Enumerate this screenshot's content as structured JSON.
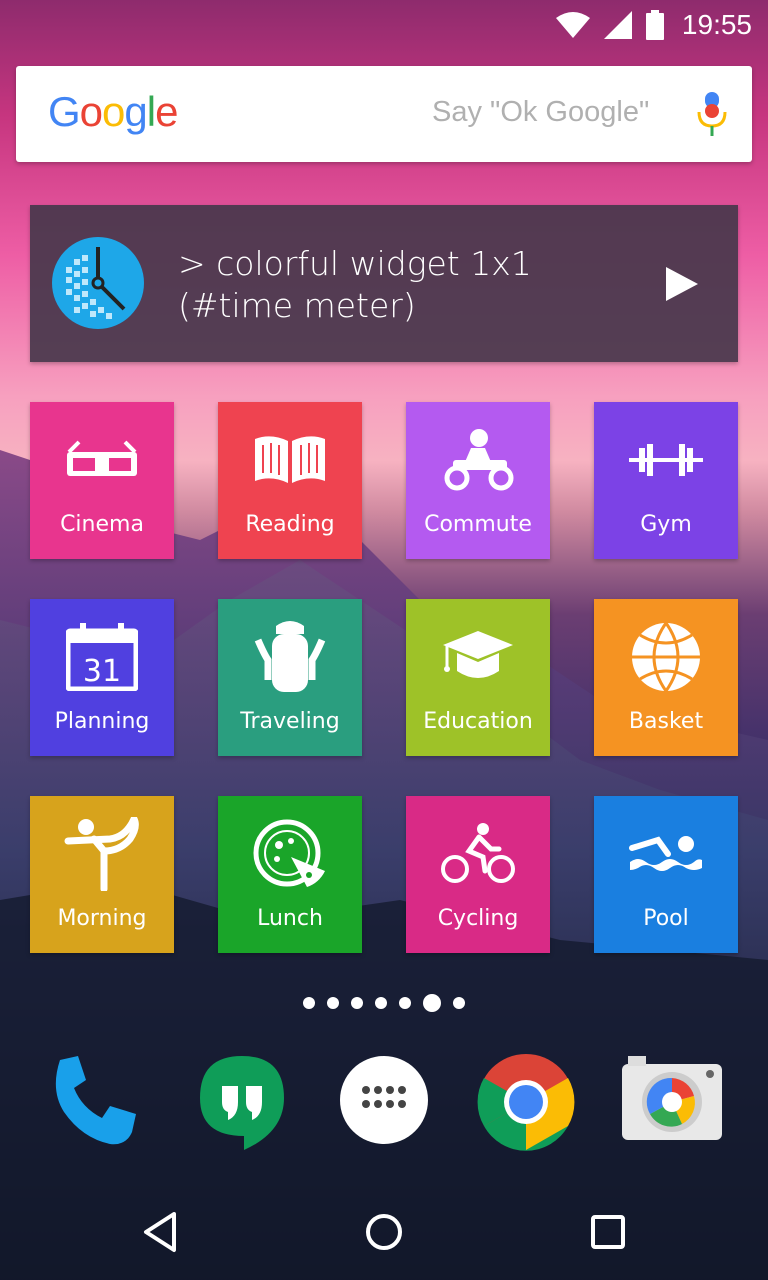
{
  "status": {
    "time": "19:55"
  },
  "search": {
    "logo_letters": [
      "G",
      "o",
      "o",
      "g",
      "l",
      "e"
    ],
    "hint": "Say \"Ok Google\""
  },
  "widget": {
    "line1": "> colorful widget 1x1",
    "line2": "(#time meter)"
  },
  "tiles": [
    {
      "label": "Cinema",
      "color": "#e8358e"
    },
    {
      "label": "Reading",
      "color": "#ef4350"
    },
    {
      "label": "Commute",
      "color": "#b45af0"
    },
    {
      "label": "Gym",
      "color": "#7c42e6"
    },
    {
      "label": "Planning",
      "color": "#5040e0"
    },
    {
      "label": "Traveling",
      "color": "#2a9e7f"
    },
    {
      "label": "Education",
      "color": "#9ec228"
    },
    {
      "label": "Basket",
      "color": "#f59322"
    },
    {
      "label": "Morning",
      "color": "#d7a31c"
    },
    {
      "label": "Lunch",
      "color": "#1aa529"
    },
    {
      "label": "Cycling",
      "color": "#d92a86"
    },
    {
      "label": "Pool",
      "color": "#1a7fe0"
    }
  ],
  "calendar_day": "31",
  "page_dots": {
    "count": 7,
    "active_index": 5
  },
  "dock": [
    "phone-app",
    "hangouts-app",
    "app-drawer",
    "chrome-app",
    "camera-app"
  ]
}
